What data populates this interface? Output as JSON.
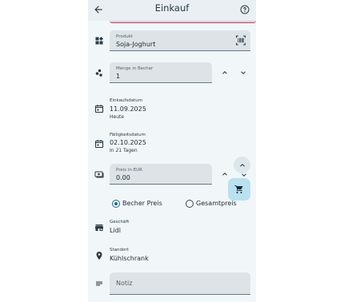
{
  "header": {
    "title": "Einkauf"
  },
  "produkt": {
    "label": "Produkt",
    "value": "Soja-Joghurt"
  },
  "menge": {
    "label": "Menge in Becher",
    "value": "1"
  },
  "einkaufsdatum": {
    "label": "Einkaufsdatum",
    "value": "11.09.2025",
    "sub": "Heute"
  },
  "faelligkeitsdatum": {
    "label": "Fälligkeitsdatum",
    "value": "02.10.2025",
    "sub": "In 21 Tagen"
  },
  "preis": {
    "label": "Preis in EUR",
    "value": "0.00"
  },
  "price_type": {
    "option_unit": "Becher Preis",
    "option_total": "Gesamtpreis",
    "selected": "Becher Preis"
  },
  "geschaeft": {
    "label": "Geschäft",
    "value": "Lidl"
  },
  "standort": {
    "label": "Standort",
    "value": "Kühlschrank"
  },
  "notiz": {
    "placeholder": "Notiz"
  },
  "colors": {
    "accent": "#1f6e86",
    "fab": "#b9e1ef",
    "field": "#dde3e7",
    "background": "#f1f6f9",
    "top_accent_line": "#b84a5c"
  }
}
